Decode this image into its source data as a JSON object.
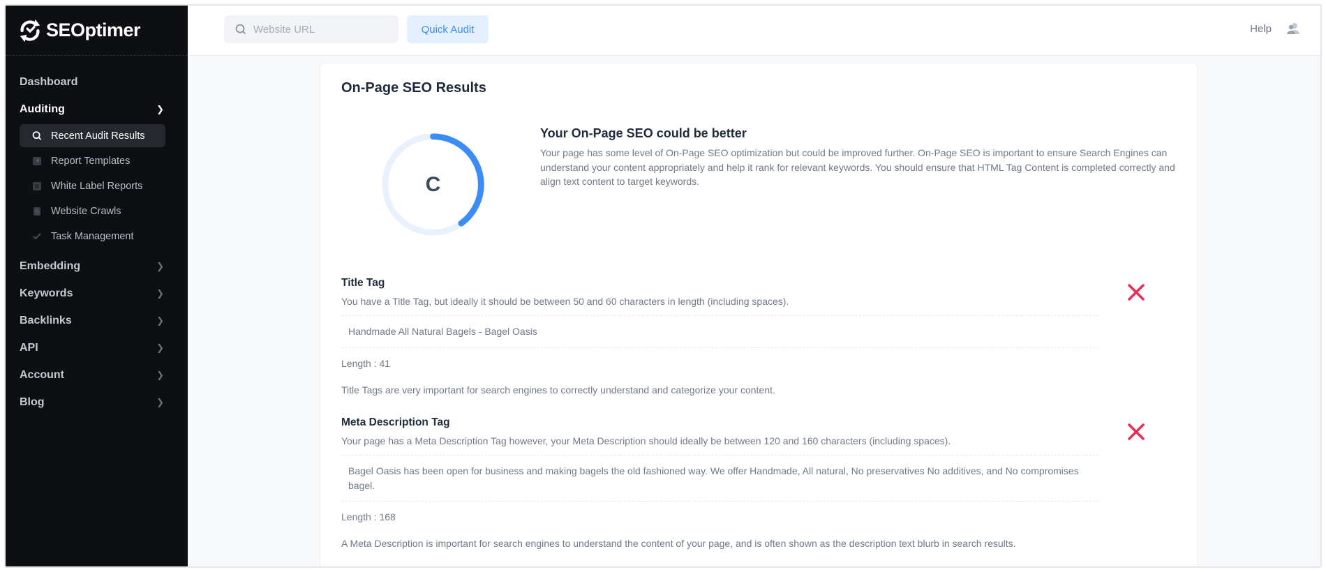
{
  "brand": {
    "name": "SEOptimer"
  },
  "sidebar": {
    "items": [
      {
        "label": "Dashboard",
        "icon": "none"
      },
      {
        "label": "Auditing",
        "icon": "chevron-right-icon"
      },
      {
        "label": "Embedding",
        "icon": "chevron-right-icon"
      },
      {
        "label": "Keywords",
        "icon": "chevron-right-icon"
      },
      {
        "label": "Backlinks",
        "icon": "chevron-right-icon"
      },
      {
        "label": "API",
        "icon": "chevron-right-icon"
      },
      {
        "label": "Account",
        "icon": "chevron-right-icon"
      },
      {
        "label": "Blog",
        "icon": "chevron-right-icon"
      }
    ],
    "auditing_sub": [
      {
        "label": "Recent Audit Results",
        "icon": "search-icon"
      },
      {
        "label": "Report Templates",
        "icon": "template-icon"
      },
      {
        "label": "White Label Reports",
        "icon": "report-icon"
      },
      {
        "label": "Website Crawls",
        "icon": "crawl-icon"
      },
      {
        "label": "Task Management",
        "icon": "check-icon"
      }
    ]
  },
  "topbar": {
    "search_placeholder": "Website URL",
    "quick_audit_label": "Quick Audit",
    "help_label": "Help"
  },
  "card": {
    "title": "On-Page SEO Results",
    "grade": "C",
    "grade_progress_pct": 40,
    "summary_heading": "Your On-Page SEO could be better",
    "summary_text": "Your page has some level of On-Page SEO optimization but could be improved further. On-Page SEO is important to ensure Search Engines can understand your content appropriately and help it rank for relevant keywords. You should ensure that HTML Tag Content is completed correctly and align text content to target keywords.",
    "checks": [
      {
        "title": "Title Tag",
        "description": "You have a Title Tag, but ideally it should be between 50 and 60 characters in length (including spaces).",
        "value": "Handmade All Natural Bagels - Bagel Oasis",
        "length": "Length : 41",
        "note": "Title Tags are very important for search engines to correctly understand and categorize your content.",
        "status": "fail"
      },
      {
        "title": "Meta Description Tag",
        "description": "Your page has a Meta Description Tag however, your Meta Description should ideally be between 120 and 160 characters (including spaces).",
        "value": "Bagel Oasis has been open for business and making bagels the old fashioned way. We offer Handmade, All natural, No preservatives No additives, and No compromises bagel.",
        "length": "Length : 168",
        "note": "A Meta Description is important for search engines to understand the content of your page, and is often shown as the description text blurb in search results.",
        "status": "fail"
      }
    ]
  },
  "colors": {
    "accent": "#3b8cf5",
    "ring_track": "#e8f1fd",
    "fail": "#ec2b55",
    "sidebar_bg": "#0d0f13"
  }
}
